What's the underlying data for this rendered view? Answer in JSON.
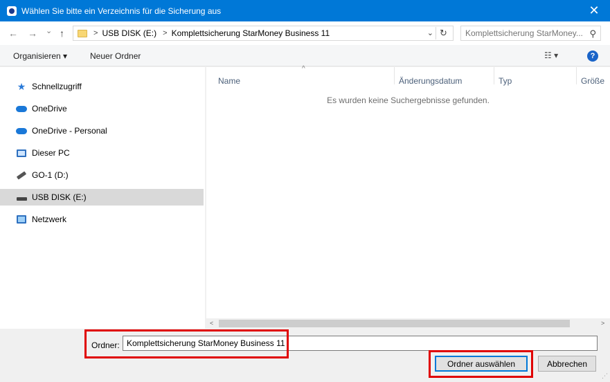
{
  "window": {
    "title": "Wählen Sie bitte ein Verzeichnis für die Sicherung aus",
    "close_glyph": "✕"
  },
  "address_bar": {
    "back_glyph": "←",
    "forward_glyph": "→",
    "recent_glyph": "⌄",
    "up_glyph": "↑",
    "breadcrumbs": [
      "USB DISK (E:)",
      "Komplettsicherung StarMoney Business 11"
    ],
    "separator": ">",
    "dropdown_glyph": "⌄",
    "refresh_glyph": "↻"
  },
  "search": {
    "placeholder": "Komplettsicherung StarMoney...",
    "icon_glyph": "⚲"
  },
  "toolbar": {
    "organize": "Organisieren ▾",
    "new_folder": "Neuer Ordner",
    "view_glyph": "☷ ▾",
    "help_glyph": "?"
  },
  "nav": {
    "items": [
      {
        "label": "Schnellzugriff",
        "icon": "star-icon"
      },
      {
        "label": "OneDrive",
        "icon": "cloud-icon"
      },
      {
        "label": "OneDrive - Personal",
        "icon": "cloud-icon"
      },
      {
        "label": "Dieser PC",
        "icon": "computer-icon"
      },
      {
        "label": "GO-1 (D:)",
        "icon": "usb-stick-icon"
      },
      {
        "label": "USB DISK (E:)",
        "icon": "drive-icon",
        "selected": true
      },
      {
        "label": "Netzwerk",
        "icon": "network-icon"
      }
    ]
  },
  "columns": {
    "name": "Name",
    "modified": "Änderungsdatum",
    "type": "Typ",
    "size": "Größe",
    "sort_glyph": "^"
  },
  "empty_message": "Es wurden keine Suchergebnisse gefunden.",
  "scrollbar": {
    "left_glyph": "<",
    "right_glyph": ">"
  },
  "footer": {
    "folder_label": "Ordner:",
    "folder_value": "Komplettsicherung StarMoney Business 11",
    "select_button": "Ordner auswählen",
    "cancel_button": "Abbrechen",
    "grip_glyph": "⋰"
  },
  "colors": {
    "accent": "#0078d7",
    "highlight": "#e00000",
    "selected_bg": "#d9d9d9"
  }
}
